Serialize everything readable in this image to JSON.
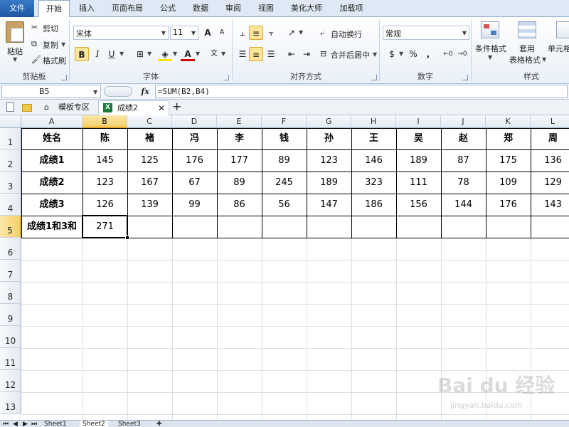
{
  "ribbon_tabs": [
    "文件",
    "开始",
    "插入",
    "页面布局",
    "公式",
    "数据",
    "审阅",
    "视图",
    "美化大师",
    "加载项"
  ],
  "clipboard": {
    "paste": "粘贴",
    "cut": "剪切",
    "copy": "复制",
    "format_painter": "格式刷",
    "group": "剪贴板"
  },
  "font": {
    "name": "宋体",
    "size": "11",
    "bold": "B",
    "italic": "I",
    "underline": "U",
    "grow": "A",
    "shrink": "A",
    "group": "字体"
  },
  "alignment": {
    "wrap": "自动换行",
    "merge": "合并后居中",
    "group": "对齐方式"
  },
  "number": {
    "format": "常规",
    "percent": "%",
    "comma": ",",
    "group": "数字"
  },
  "styles": {
    "conditional": "条件格式",
    "table_format_1": "套用",
    "table_format_2": "表格格式",
    "cell_styles": "单元格",
    "group": "样式"
  },
  "formula_bar": {
    "name_box": "B5",
    "fx": "fx",
    "formula": "=SUM(B2,B4)"
  },
  "doc_tabs": [
    "模板专区",
    "成绩2"
  ],
  "columns": [
    "A",
    "B",
    "C",
    "D",
    "E",
    "F",
    "G",
    "H",
    "I",
    "J",
    "K",
    "L"
  ],
  "rows": [
    "1",
    "2",
    "3",
    "4",
    "5",
    "6",
    "7",
    "8",
    "9",
    "10",
    "11",
    "12",
    "13"
  ],
  "table": {
    "header": [
      "姓名",
      "陈",
      "褚",
      "冯",
      "李",
      "钱",
      "孙",
      "王",
      "吴",
      "赵",
      "郑",
      "周"
    ],
    "rows": [
      [
        "成绩1",
        "145",
        "125",
        "176",
        "177",
        "89",
        "123",
        "146",
        "189",
        "87",
        "175",
        "136"
      ],
      [
        "成绩2",
        "123",
        "167",
        "67",
        "89",
        "245",
        "189",
        "323",
        "111",
        "78",
        "109",
        "129"
      ],
      [
        "成绩3",
        "126",
        "139",
        "99",
        "86",
        "56",
        "147",
        "186",
        "156",
        "144",
        "176",
        "143"
      ],
      [
        "成绩1和3和",
        "271",
        "",
        "",
        "",
        "",
        "",
        "",
        "",
        "",
        "",
        ""
      ]
    ]
  },
  "sheet_tabs": [
    "Sheet1",
    "Sheet2",
    "Sheet3"
  ],
  "watermark": {
    "logo": "Bai du 经验",
    "url": "jingyan.baidu.com"
  },
  "colors": {
    "selection": "#f6cf6a",
    "file_tab": "#2b6cb7"
  }
}
